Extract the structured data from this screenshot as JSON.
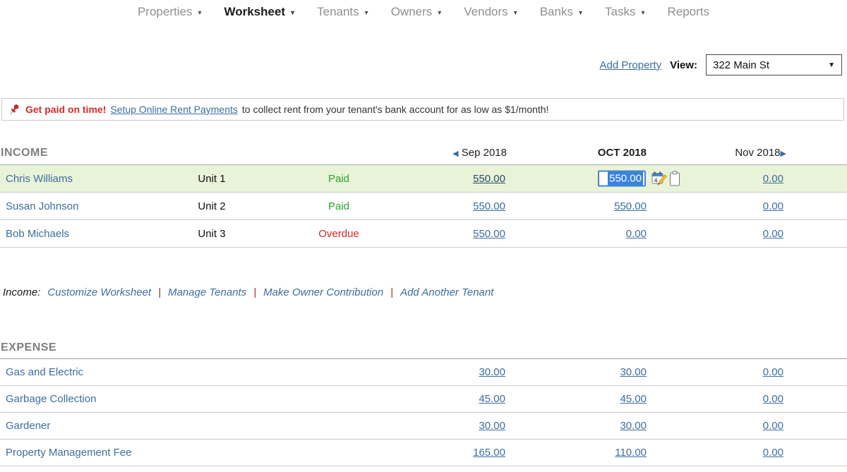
{
  "nav": {
    "items": [
      {
        "label": "Properties",
        "has_dropdown": true,
        "active": false
      },
      {
        "label": "Worksheet",
        "has_dropdown": true,
        "active": true
      },
      {
        "label": "Tenants",
        "has_dropdown": true,
        "active": false
      },
      {
        "label": "Owners",
        "has_dropdown": true,
        "active": false
      },
      {
        "label": "Vendors",
        "has_dropdown": true,
        "active": false
      },
      {
        "label": "Banks",
        "has_dropdown": true,
        "active": false
      },
      {
        "label": "Tasks",
        "has_dropdown": true,
        "active": false
      },
      {
        "label": "Reports",
        "has_dropdown": false,
        "active": false
      }
    ]
  },
  "toolbar": {
    "add_property_label": "Add Property",
    "view_label": "View:",
    "view_value": "322 Main St"
  },
  "banner": {
    "highlight": "Get paid on time!",
    "link_label": "Setup Online Rent Payments",
    "rest": "to collect rent from your tenant's bank account for as low as $1/month!"
  },
  "income": {
    "section_label": "INCOME",
    "columns": {
      "prev": "Sep 2018",
      "current": "OCT 2018",
      "next": "Nov 2018"
    },
    "rows": [
      {
        "name": "Chris Williams",
        "unit": "Unit 1",
        "status": "Paid",
        "prev": "550.00",
        "current": "550.00",
        "next": "0.00",
        "current_editing": true
      },
      {
        "name": "Susan Johnson",
        "unit": "Unit 2",
        "status": "Paid",
        "prev": "550.00",
        "current": "550.00",
        "next": "0.00",
        "current_editing": false
      },
      {
        "name": "Bob Michaels",
        "unit": "Unit 3",
        "status": "Overdue",
        "prev": "550.00",
        "current": "0.00",
        "next": "0.00",
        "current_editing": false
      }
    ],
    "footer": {
      "prefix": "Income:",
      "separator": "|",
      "links": [
        "Customize Worksheet",
        "Manage Tenants",
        "Make Owner Contribution",
        "Add Another Tenant"
      ]
    }
  },
  "expense": {
    "section_label": "EXPENSE",
    "rows": [
      {
        "name": "Gas and Electric",
        "prev": "30.00",
        "current": "30.00",
        "next": "0.00"
      },
      {
        "name": "Garbage Collection",
        "prev": "45.00",
        "current": "45.00",
        "next": "0.00"
      },
      {
        "name": "Gardener",
        "prev": "30.00",
        "current": "30.00",
        "next": "0.00"
      },
      {
        "name": "Property Management Fee",
        "prev": "165.00",
        "current": "110.00",
        "next": "0.00"
      }
    ]
  },
  "icons": {
    "nav_caret": "▾",
    "select_arrow": "▼",
    "prev_arrow": "◀",
    "next_arrow": "▶",
    "pushpin": "pushpin-icon",
    "calendar_edit": "calendar-edit-icon",
    "receipt": "clipboard-receipt-icon"
  },
  "colors": {
    "link_blue": "#3d6d9e",
    "paid_green": "#2da12d",
    "overdue_red": "#cc2a2a",
    "banner_red": "#d42a2a",
    "highlight_row_green": "#e9f3d8",
    "input_border_blue": "#3f85d6",
    "selection_blue": "#3b82d9",
    "nav_gray": "#8f8f8f"
  }
}
